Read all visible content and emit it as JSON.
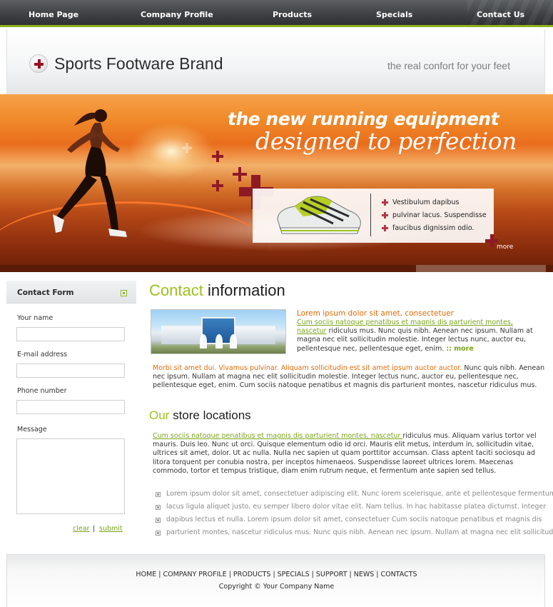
{
  "nav": {
    "items": [
      "Home Page",
      "Company Profile",
      "Products",
      "Specials",
      "Contact Us"
    ]
  },
  "header": {
    "brand": "Sports Footware Brand",
    "tagline": "the real confort for your feet"
  },
  "banner": {
    "headline1": "the new running equipment",
    "headline2": "designed to perfection",
    "features": [
      "Vestibulum dapibus",
      "pulvinar lacus. Suspendisse",
      "faucibus dignissim odio."
    ],
    "more": "more"
  },
  "contact_form": {
    "title": "Contact Form",
    "name_label": "Your name",
    "email_label": "E-mail address",
    "phone_label": "Phone number",
    "message_label": "Message",
    "clear": "clear",
    "submit": "submit",
    "separator": "|"
  },
  "contact_info": {
    "title_green": "Contact",
    "title_rest": " information",
    "p1_title": "Lorem ipsum dolor sit amet, consectetuer",
    "p1_link": "Cum sociis natoque penatibus et magnis dis parturient montes, nascetur",
    "p1_text": " ridiculus mus. Nunc quis nibh. Aenean nec ipsum. Nullam at magna nec elit sollicitudin molestie. Integer lectus nunc, auctor eu, pellentesque nec, pellentesque eget, enim. ",
    "p1_more": ":: more",
    "p2_orange": "Morbi sit amet dui. Vivamus pulvinar. Aliquam sollicitudin est sit amet ipsum auctor auctor.",
    "p2_text": " Nunc quis nibh. Aenean nec ipsum. Nullam at magna nec elit sollicitudin molestie. Integer lectus nunc, auctor eu, pellentesque nec, pellentesque eget, enim. Cum sociis natoque penatibus et magnis dis parturient montes, nascetur ridiculus mus."
  },
  "store_locations": {
    "title_green": "Our",
    "title_rest": " store locations",
    "link": "Cum sociis natoque penatibus et magnis dis parturient montes, nascetur ",
    "text": "ridiculus mus. Aliquam varius tortor vel mauris. Duis leo. Nunc ut orci. Quisque elementum odio id orci. Mauris elit metus, interdum in, sollicitudin vitae, ultrices sit amet, dolor. Ut ac nulla. Nulla nec sapien ut quam porttitor accumsan. Class aptent taciti sociosqu ad litora torquent per conubia nostra, per inceptos himenaeos. Suspendisse laoreet ultrices lorem. Maecenas commodo, tortor et tempus tristique, diam enim rutrum neque, et fermentum ante sapien sed tellus.",
    "list": [
      "Lorem ipsum dolor sit amet, consectetuer adipiscing elit. Nunc lorem scelerisque, ante et pellentesque fermentum,",
      "lacus ligula aliquet justo, eu semper libero dolor vitae elit. Nam tellus. In hac habitasse platea dictumst. Integer",
      "dapibus lectus et nulla. Lorem ipsum dolor sit amet, consectetuer Cum sociis natoque penatibus et magnis dis",
      "parturient montes, nascetur ridiculus mus. Nunc quis nibh. Aenean nec ipsum. Nullam at magna nec elit sollicitudin"
    ]
  },
  "footer": {
    "links": [
      "HOME",
      "COMPANY PROFILE",
      "PRODUCTS",
      "SPECIALS",
      "SUPPORT",
      "NEWS",
      "CONTACTS"
    ],
    "separator": "|",
    "copyright": "Copyright © Your Company Name"
  },
  "colors": {
    "accent_green": "#9bc21e",
    "accent_orange": "#e26b0a",
    "nav_bg": "#3f4245",
    "cross_red": "#8e1a26"
  },
  "icons": [
    "logo-cross-icon",
    "form-box-icon",
    "cross-bullet-icon",
    "square-bullet-icon",
    "shoe-image",
    "runner-image"
  ]
}
